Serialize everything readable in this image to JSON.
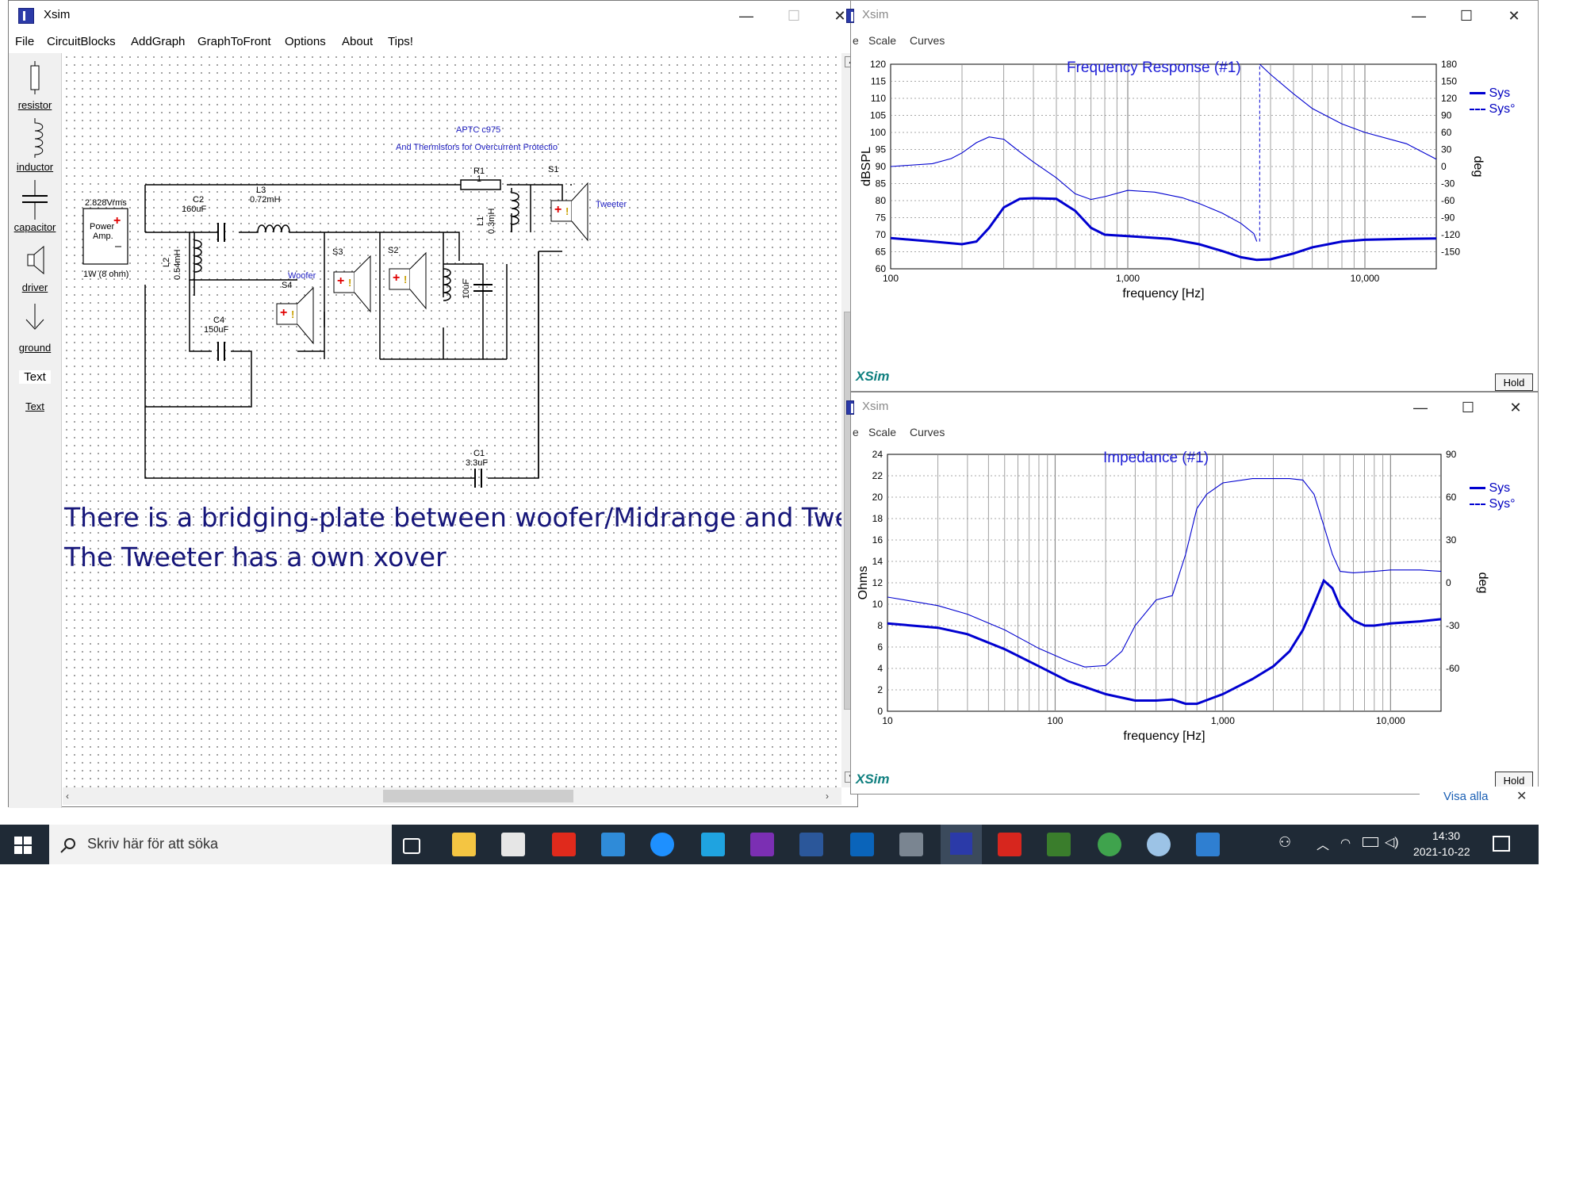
{
  "main_window": {
    "title": "Xsim",
    "controls": {
      "minimize": "—",
      "maximize": "☐",
      "close": "✕"
    },
    "menu": [
      "File",
      "CircuitBlocks",
      "AddGraph",
      "GraphToFront",
      "Options",
      "About",
      "Tips!"
    ],
    "palette": [
      "resistor",
      "inductor",
      "capacitor",
      "driver",
      "ground",
      "Text",
      "Text"
    ]
  },
  "schematic": {
    "header1": "APTC c975",
    "header2": "And Thermistors for Overcurrent Protectio",
    "source_voltage": "2.828Vrms",
    "source_label1": "Power",
    "source_label2": "Amp.",
    "source_load": "1W (8 ohm)",
    "r1_name": "R1",
    "r1_value": "1",
    "s1": "S1",
    "tweeter": "Tweeter",
    "l1": "L1",
    "l1_value": "0.3mH",
    "c2": "C2",
    "c2_value": "160uF",
    "l3": "L3",
    "l3_value": "0.72mH",
    "l2": "L2",
    "l2_value": "0.54mH",
    "woofer": "Woofer",
    "s4": "S4",
    "c4": "C4",
    "c4_value": "150uF",
    "s3": "S3",
    "s2": "S2",
    "cap_10uf": "10uF",
    "c1": "C1",
    "c1_value": "3.3uF"
  },
  "notes": {
    "line1": "There is a bridging-plate between woofer/Midrange and Tweeter",
    "line2": "The Tweeter has a own xover"
  },
  "freq_window": {
    "title": "Xsim",
    "menu": [
      "e",
      "Scale",
      "Curves"
    ],
    "controls": {
      "minimize": "—",
      "maximize": "☐",
      "close": "✕"
    },
    "hold": "Hold",
    "logo": "XSim"
  },
  "imp_window": {
    "title": "Xsim",
    "menu": [
      "e",
      "Scale",
      "Curves"
    ],
    "controls": {
      "minimize": "—",
      "maximize": "☐",
      "close": "✕"
    },
    "hold": "Hold",
    "logo": "XSim"
  },
  "chart_data": [
    {
      "type": "line",
      "title": "Frequency Response (#1)",
      "xlabel": "frequency [Hz]",
      "ylabel": "dBSPL",
      "y2label": "deg",
      "xscale": "log",
      "xlim": [
        100,
        20000
      ],
      "ylim": [
        60,
        120
      ],
      "y2lim": [
        -180,
        180
      ],
      "xticks": [
        "100",
        "1,000",
        "10,000"
      ],
      "yticks": [
        "120",
        "115",
        "110",
        "105",
        "100",
        "95",
        "90",
        "85",
        "80",
        "75",
        "70",
        "65",
        "60"
      ],
      "y2ticks": [
        "180",
        "150",
        "120",
        "90",
        "60",
        "30",
        "0",
        "-30",
        "-60",
        "-90",
        "-120",
        "-150"
      ],
      "grid": true,
      "legend": "right",
      "series": [
        {
          "name": "Sys",
          "axis": "left",
          "style": "solid-thick",
          "x": [
            100,
            150,
            200,
            230,
            260,
            300,
            350,
            400,
            500,
            600,
            700,
            800,
            1000,
            1500,
            2000,
            2500,
            3000,
            3500,
            4000,
            5000,
            6000,
            8000,
            10000,
            15000,
            20000
          ],
          "y": [
            69,
            68,
            67.2,
            68,
            72,
            78,
            80.5,
            80.7,
            80.5,
            77,
            72,
            70,
            69.6,
            68.8,
            67.2,
            65.2,
            63.4,
            62.6,
            62.8,
            64.5,
            66.3,
            68,
            68.5,
            68.8,
            68.9
          ]
        },
        {
          "name": "Sys°",
          "axis": "right",
          "style": "solid-thin",
          "x": [
            100,
            150,
            180,
            200,
            230,
            260,
            300,
            350,
            400,
            500,
            600,
            700,
            800,
            1000,
            1300,
            1700,
            2000,
            2500,
            3000,
            3400,
            3500,
            3600,
            4000,
            5000,
            6000,
            8000,
            10000,
            15000,
            20000
          ],
          "y": [
            0,
            5,
            14,
            24,
            42,
            52,
            48,
            26,
            8,
            -20,
            -48,
            -58,
            -53,
            -42,
            -45,
            -55,
            -65,
            -82,
            -100,
            -118,
            -132,
            180,
            162,
            128,
            102,
            75,
            60,
            40,
            13
          ]
        }
      ]
    },
    {
      "type": "line",
      "title": "Impedance (#1)",
      "xlabel": "frequency [Hz]",
      "ylabel": "Ohms",
      "y2label": "deg",
      "xscale": "log",
      "xlim": [
        10,
        20000
      ],
      "ylim": [
        0,
        24
      ],
      "y2lim": [
        -90,
        90
      ],
      "xticks": [
        "10",
        "100",
        "1,000",
        "10,000"
      ],
      "yticks": [
        "24",
        "22",
        "20",
        "18",
        "16",
        "14",
        "12",
        "10",
        "8",
        "6",
        "4",
        "2",
        "0"
      ],
      "y2ticks": [
        "90",
        "60",
        "30",
        "0",
        "-30",
        "-60"
      ],
      "grid": true,
      "legend": "right",
      "series": [
        {
          "name": "Sys",
          "axis": "left",
          "style": "solid-thick",
          "x": [
            10,
            20,
            30,
            50,
            80,
            120,
            200,
            300,
            400,
            500,
            600,
            700,
            1000,
            1500,
            2000,
            2500,
            3000,
            3500,
            4000,
            4500,
            5000,
            6000,
            7000,
            8000,
            10000,
            15000,
            20000
          ],
          "y": [
            8.2,
            7.8,
            7.2,
            5.8,
            4.2,
            2.8,
            1.6,
            1.0,
            1.0,
            1.1,
            0.7,
            0.7,
            1.6,
            3.0,
            4.2,
            5.6,
            7.6,
            10.0,
            12.2,
            11.5,
            9.8,
            8.5,
            8.0,
            8.0,
            8.2,
            8.4,
            8.6
          ]
        },
        {
          "name": "Sys°",
          "axis": "right",
          "style": "solid-thin",
          "x": [
            10,
            20,
            30,
            50,
            80,
            120,
            150,
            200,
            250,
            300,
            400,
            500,
            600,
            700,
            800,
            1000,
            1500,
            2000,
            2500,
            3000,
            3500,
            4000,
            4500,
            5000,
            6000,
            8000,
            10000,
            15000,
            20000
          ],
          "y": [
            -10,
            -16,
            -22,
            -33,
            -46,
            -55,
            -59,
            -58,
            -48,
            -30,
            -12,
            -9,
            20,
            52,
            62,
            70,
            73,
            73,
            73,
            72,
            62,
            40,
            20,
            8,
            7,
            8,
            9,
            9,
            8
          ]
        }
      ]
    }
  ],
  "taskbar": {
    "search_placeholder": "Skriv här för att söka",
    "time": "14:30",
    "date": "2021-10-22",
    "visa_alla": "Visa alla"
  },
  "colors": {
    "curve": "#0000d0",
    "grid": "#8a8a8a",
    "title_blue": "#1d1dd6",
    "schematic_text": "#16167a"
  }
}
